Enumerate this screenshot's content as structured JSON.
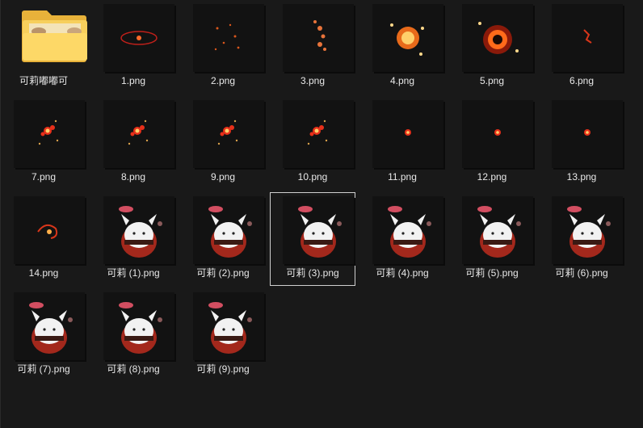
{
  "folder": {
    "label": "可莉嘟嘟可",
    "icon": "folder-icon"
  },
  "files": [
    {
      "label": "1.png",
      "thumb": "fx-ring"
    },
    {
      "label": "2.png",
      "thumb": "fx-sparks"
    },
    {
      "label": "3.png",
      "thumb": "fx-trail"
    },
    {
      "label": "4.png",
      "thumb": "fx-orb"
    },
    {
      "label": "5.png",
      "thumb": "fx-blast"
    },
    {
      "label": "6.png",
      "thumb": "fx-small"
    },
    {
      "label": "7.png",
      "thumb": "fx-flower"
    },
    {
      "label": "8.png",
      "thumb": "fx-flower"
    },
    {
      "label": "9.png",
      "thumb": "fx-flower"
    },
    {
      "label": "10.png",
      "thumb": "fx-flower"
    },
    {
      "label": "11.png",
      "thumb": "fx-dot"
    },
    {
      "label": "12.png",
      "thumb": "fx-dot"
    },
    {
      "label": "13.png",
      "thumb": "fx-dot"
    },
    {
      "label": "14.png",
      "thumb": "fx-swirl"
    },
    {
      "label": "可莉 (1).png",
      "thumb": "dodoco"
    },
    {
      "label": "可莉 (2).png",
      "thumb": "dodoco"
    },
    {
      "label": "可莉 (3).png",
      "thumb": "dodoco",
      "selected": true
    },
    {
      "label": "可莉 (4).png",
      "thumb": "dodoco"
    },
    {
      "label": "可莉 (5).png",
      "thumb": "dodoco"
    },
    {
      "label": "可莉 (6).png",
      "thumb": "dodoco"
    },
    {
      "label": "可莉 (7).png",
      "thumb": "dodoco"
    },
    {
      "label": "可莉 (8).png",
      "thumb": "dodoco"
    },
    {
      "label": "可莉 (9).png",
      "thumb": "dodoco"
    }
  ]
}
